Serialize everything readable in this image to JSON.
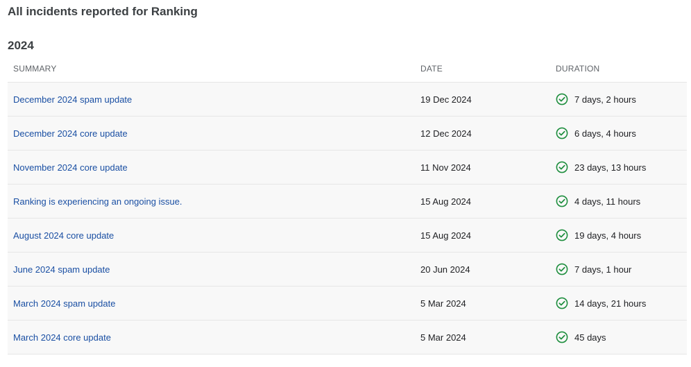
{
  "page": {
    "title": "All incidents reported for Ranking"
  },
  "year_section": {
    "year": "2024"
  },
  "table": {
    "headers": {
      "summary": "SUMMARY",
      "date": "DATE",
      "duration": "DURATION"
    },
    "rows": [
      {
        "summary": "December 2024 spam update",
        "date": "19 Dec 2024",
        "duration": "7 days, 2 hours",
        "status_icon": "check-circle-icon"
      },
      {
        "summary": "December 2024 core update",
        "date": "12 Dec 2024",
        "duration": "6 days, 4 hours",
        "status_icon": "check-circle-icon"
      },
      {
        "summary": "November 2024 core update",
        "date": "11 Nov 2024",
        "duration": "23 days, 13 hours",
        "status_icon": "check-circle-icon"
      },
      {
        "summary": "Ranking is experiencing an ongoing issue.",
        "date": "15 Aug 2024",
        "duration": "4 days, 11 hours",
        "status_icon": "check-circle-icon"
      },
      {
        "summary": "August 2024 core update",
        "date": "15 Aug 2024",
        "duration": "19 days, 4 hours",
        "status_icon": "check-circle-icon"
      },
      {
        "summary": "June 2024 spam update",
        "date": "20 Jun 2024",
        "duration": "7 days, 1 hour",
        "status_icon": "check-circle-icon"
      },
      {
        "summary": "March 2024 spam update",
        "date": "5 Mar 2024",
        "duration": "14 days, 21 hours",
        "status_icon": "check-circle-icon"
      },
      {
        "summary": "March 2024 core update",
        "date": "5 Mar 2024",
        "duration": "45 days",
        "status_icon": "check-circle-icon"
      }
    ]
  },
  "colors": {
    "link": "#1a4fa3",
    "resolved_check": "#1e8e3e",
    "row_background": "#f8f8f8",
    "divider": "#e6e6e6"
  }
}
